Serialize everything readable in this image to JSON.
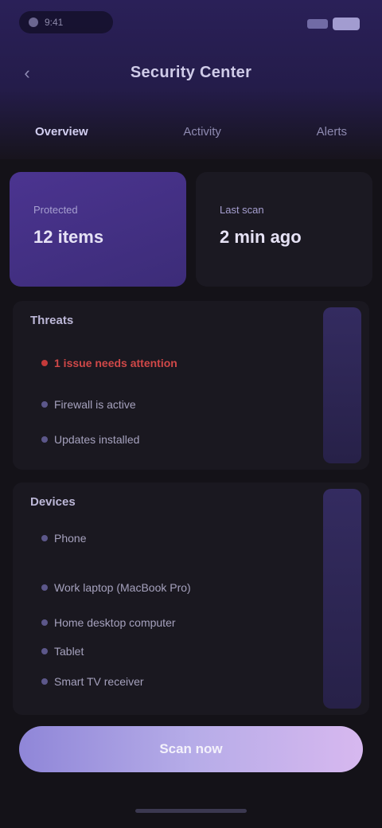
{
  "status_bar": {
    "time": "9:41"
  },
  "header": {
    "title": "Security Center"
  },
  "tabs": [
    {
      "label": "Overview",
      "active": true
    },
    {
      "label": "Activity",
      "active": false
    },
    {
      "label": "Alerts",
      "active": false
    }
  ],
  "summary": [
    {
      "label": "Protected",
      "value": "12 items"
    },
    {
      "label": "Last scan",
      "value": "2 min ago"
    }
  ],
  "section_threats": {
    "title": "Threats",
    "items": [
      {
        "label": "1 issue needs attention",
        "alert": true
      },
      {
        "label": "Firewall is active",
        "alert": false
      },
      {
        "label": "Updates installed",
        "alert": false
      }
    ]
  },
  "section_devices": {
    "title": "Devices",
    "items": [
      {
        "label": "Phone"
      },
      {
        "label": "Work laptop (MacBook Pro)"
      },
      {
        "label": "Home desktop computer"
      },
      {
        "label": "Tablet"
      },
      {
        "label": "Smart TV receiver"
      }
    ]
  },
  "cta": {
    "label": "Scan now"
  },
  "colors": {
    "accent": "#4b3490",
    "alert": "#d04848",
    "cta_start": "#8f86d8",
    "cta_end": "#d7b8ef"
  }
}
